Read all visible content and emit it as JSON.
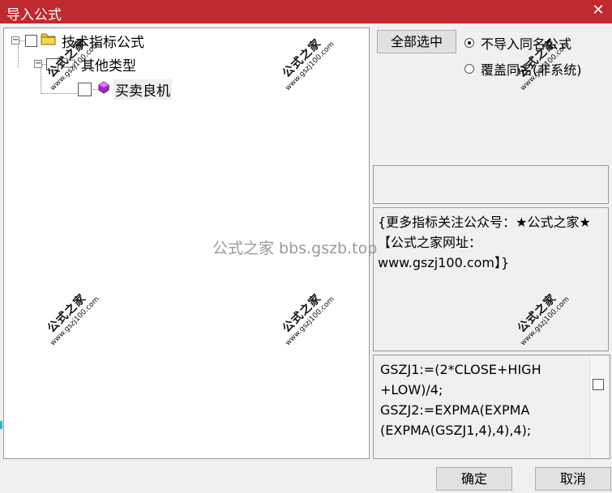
{
  "window": {
    "title": "导入公式",
    "close_glyph": "✕"
  },
  "tree": {
    "root": {
      "label": "技术指标公式",
      "expander": "−",
      "icon": "folder-icon"
    },
    "child": {
      "label": "其他类型",
      "expander": "−"
    },
    "leaf": {
      "label": "买卖良机",
      "icon": "formula-icon"
    }
  },
  "buttons": {
    "select_all": "全部选中",
    "ok": "确定",
    "cancel": "取消"
  },
  "options": [
    {
      "label": "不导入同名公式",
      "selected": true
    },
    {
      "label": "覆盖同名(非系统)",
      "selected": false
    }
  ],
  "description": "{更多指标关注公众号：★公式之家★ 【公式之家网址：www.gszj100.com】}",
  "code_lines": [
    "GSZJ1:=(2*CLOSE+HIGH",
    "+LOW)/4;",
    "GSZJ2:=EXPMA(EXPMA",
    "(EXPMA(GSZJ1,4),4),4);"
  ],
  "watermark": {
    "big": "公式之家",
    "small": "www.gszj100.com",
    "center": "公式之家 bbs.gszb.top"
  }
}
